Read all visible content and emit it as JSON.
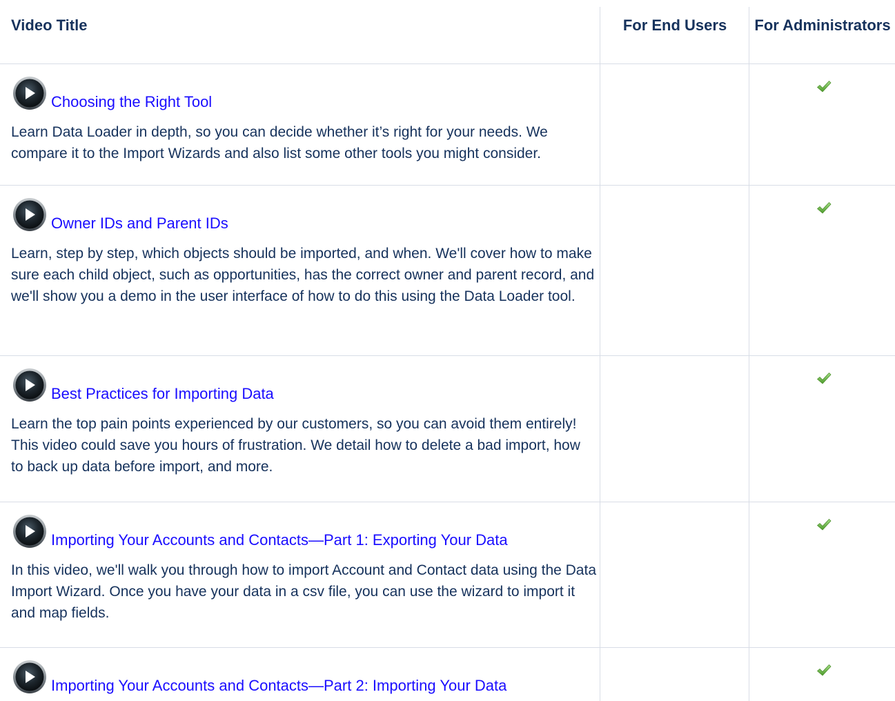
{
  "table": {
    "headers": {
      "video_title": "Video Title",
      "end_users": "For End Users",
      "administrators": "For Administrators"
    },
    "rows": [
      {
        "title": "Choosing the Right Tool",
        "description": "Learn Data Loader in depth, so you can decide whether it’s right for your needs. We compare it to the Import Wizards and also list some other tools you might consider.",
        "end_users": false,
        "administrators": true
      },
      {
        "title": "Owner IDs and Parent IDs",
        "description": "Learn, step by step, which objects should be imported, and when. We'll cover how to make sure each child object, such as opportunities, has the correct owner and parent record, and we'll show you a demo in the user interface of how to do this using the Data Loader tool.",
        "end_users": false,
        "administrators": true
      },
      {
        "title": "Best Practices for Importing Data",
        "description": "Learn the top pain points experienced by our customers, so you can avoid them entirely! This video could save you hours of frustration. We detail how to delete a bad import, how to back up data before import, and more.",
        "end_users": false,
        "administrators": true
      },
      {
        "title": "Importing Your Accounts and Contacts—Part 1: Exporting Your Data",
        "description": "In this video, we'll walk you through how to import Account and Contact data using the Data Import Wizard. Once you have your data in a csv file, you can use the wizard to import it and map fields.",
        "end_users": false,
        "administrators": true
      },
      {
        "title": "Importing Your Accounts and Contacts—Part 2: Importing Your Data",
        "description": "",
        "end_users": false,
        "administrators": true
      }
    ]
  },
  "icons": {
    "play": "play-icon",
    "check": "check-icon"
  },
  "colors": {
    "link": "#1a0dff",
    "text": "#16325c",
    "check": "#5cb85c",
    "border": "#d8dde6"
  }
}
